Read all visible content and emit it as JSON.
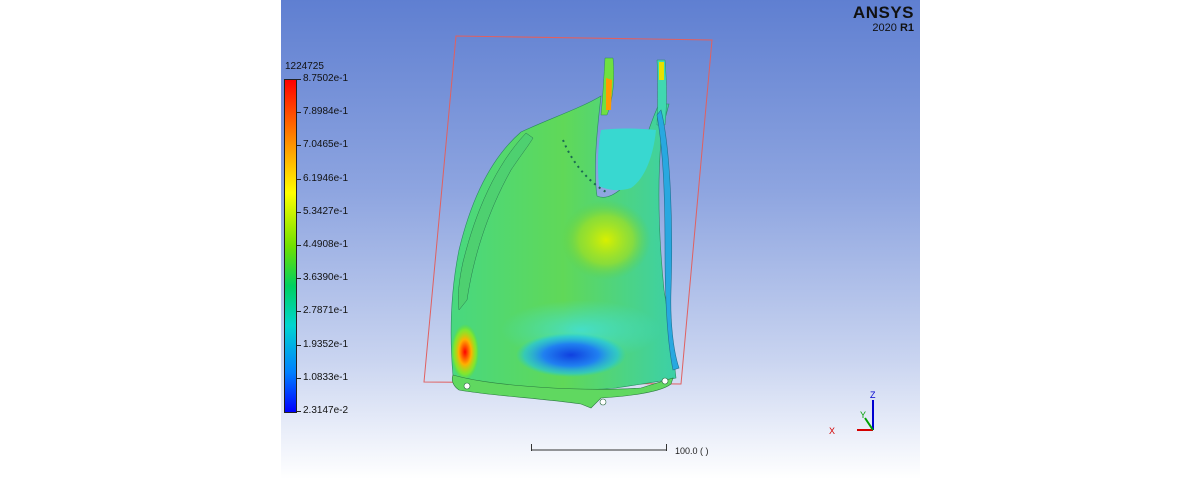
{
  "brand": {
    "name": "ANSYS",
    "version": "2020",
    "release": "R1"
  },
  "legend": {
    "title": "1224725",
    "labels": [
      "8.7502e-1",
      "7.8984e-1",
      "7.0465e-1",
      "6.1946e-1",
      "5.3427e-1",
      "4.4908e-1",
      "3.6390e-1",
      "2.7871e-1",
      "1.9352e-1",
      "1.0833e-1",
      "2.3147e-2"
    ]
  },
  "scale": {
    "label": "100.0  (  )"
  },
  "triad": {
    "x": "X",
    "y": "Y",
    "z": "Z"
  },
  "colors": {
    "x_axis": "#d40000",
    "y_axis": "#00a000",
    "z_axis": "#0000d0",
    "box": "#e06060"
  }
}
